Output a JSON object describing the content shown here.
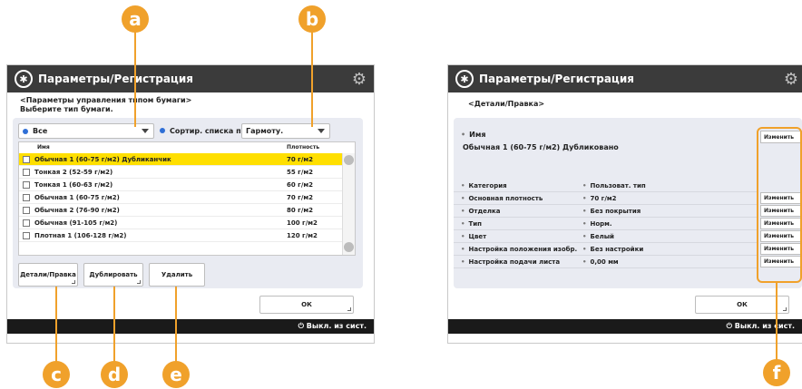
{
  "callouts": {
    "a": "a",
    "b": "b",
    "c": "c",
    "d": "d",
    "e": "e",
    "f": "f"
  },
  "left": {
    "title": "Параметры/Регистрация",
    "breadcrumb": "<Параметры управления типом бумаги>",
    "instruction": "Выберите тип бумаги.",
    "filter_value": "Все",
    "sort_label": "Сортир. списка по",
    "sort_value": "Гармоту.",
    "list_header_name": "Имя",
    "list_header_weight": "Плотность",
    "rows": [
      {
        "name": "Обычная 1 (60-75 г/м2) Дубликанчик",
        "weight": "70 г/м2",
        "selected": true
      },
      {
        "name": "Тонкая 2 (52-59 г/м2)",
        "weight": "55 г/м2",
        "selected": false
      },
      {
        "name": "Тонкая 1 (60-63 г/м2)",
        "weight": "60 г/м2",
        "selected": false
      },
      {
        "name": "Обычная 1 (60-75 г/м2)",
        "weight": "70 г/м2",
        "selected": false
      },
      {
        "name": "Обычная 2 (76-90 г/м2)",
        "weight": "80 г/м2",
        "selected": false
      },
      {
        "name": "Обычная (91-105 г/м2)",
        "weight": "100 г/м2",
        "selected": false
      },
      {
        "name": "Плотная 1 (106-128 г/м2)",
        "weight": "120 г/м2",
        "selected": false
      }
    ],
    "btn_details": "Детали/Правка",
    "btn_duplicate": "Дублировать",
    "btn_delete": "Удалить",
    "btn_ok": "ОК",
    "footer": "Выкл. из сист."
  },
  "right": {
    "title": "Параметры/Регистрация",
    "breadcrumb": "<Детали/Правка>",
    "name_label": "Имя",
    "name_value": "Обычная 1 (60-75 г/м2) Дубликовано",
    "rows": [
      {
        "key": "Категория",
        "value": "Пользоват. тип",
        "has_edit": false
      },
      {
        "key": "Основная плотность",
        "value": "70 г/м2",
        "has_edit": true
      },
      {
        "key": "Отделка",
        "value": "Без покрытия",
        "has_edit": true
      },
      {
        "key": "Тип",
        "value": "Норм.",
        "has_edit": true
      },
      {
        "key": "Цвет",
        "value": "Белый",
        "has_edit": true
      },
      {
        "key": "Настройка положения изобр.",
        "value": "Без настройки",
        "has_edit": true
      },
      {
        "key": "Настройка подачи листа",
        "value": "0,00 мм",
        "has_edit": true
      }
    ],
    "edit_label": "Изменить",
    "btn_ok": "ОК",
    "footer": "Выкл. из сист."
  }
}
